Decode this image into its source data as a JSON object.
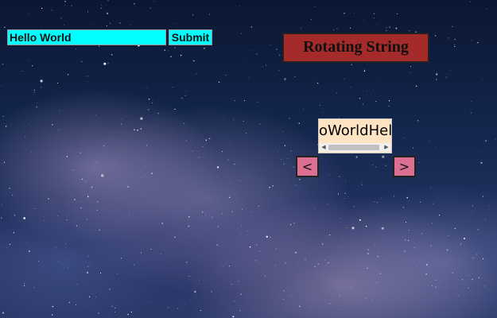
{
  "form": {
    "input_value": "Hello World",
    "submit_label": "Submit",
    "input_color": "#00ffff"
  },
  "title": {
    "text": "Rotating String",
    "color": "#a52a2a"
  },
  "display": {
    "text": "oWorldHel",
    "background": "#ffe4c4"
  },
  "nav": {
    "prev_label": "<",
    "next_label": ">",
    "color": "#db7093"
  },
  "icons": {
    "scroll_left": "triangle-left-icon",
    "scroll_right": "triangle-right-icon"
  }
}
